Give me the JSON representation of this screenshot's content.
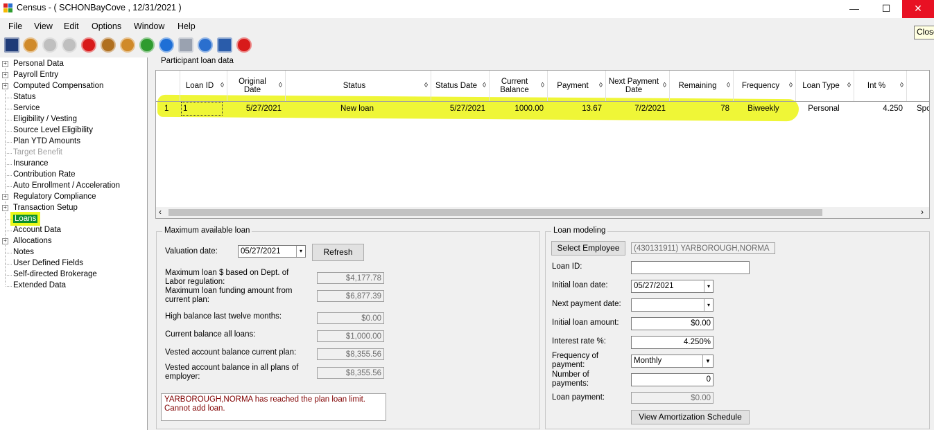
{
  "window": {
    "title": "Census -  ( SCHONBayCove , 12/31/2021 )",
    "minimize": "—",
    "maximize": "☐",
    "close": "✕",
    "tooltip": "Close"
  },
  "menu": [
    "File",
    "View",
    "Edit",
    "Options",
    "Window",
    "Help"
  ],
  "toolbar": [
    {
      "icon": "save-icon",
      "color": "#1f3b78"
    },
    {
      "icon": "person-search-icon",
      "color": "#d08a2a"
    },
    {
      "icon": "add-icon",
      "color": "#bfbfbf"
    },
    {
      "icon": "up-icon",
      "color": "#bfbfbf"
    },
    {
      "icon": "remove-icon",
      "color": "#d81a1a"
    },
    {
      "icon": "group-icon",
      "color": "#b07020"
    },
    {
      "icon": "person-icon",
      "color": "#d08a2a"
    },
    {
      "icon": "person-green-icon",
      "color": "#2f9b2f"
    },
    {
      "icon": "at-icon",
      "color": "#1e6fd6"
    },
    {
      "icon": "print-icon",
      "color": "#9aa2b0"
    },
    {
      "icon": "info-icon",
      "color": "#2a6fce"
    },
    {
      "icon": "edit-icon",
      "color": "#2a5caa"
    },
    {
      "icon": "exit-icon",
      "color": "#d81a1a"
    }
  ],
  "tree": [
    {
      "label": "Personal Data",
      "expandable": true
    },
    {
      "label": "Payroll Entry",
      "expandable": true
    },
    {
      "label": "Computed Compensation",
      "expandable": true
    },
    {
      "label": "Status",
      "expandable": false
    },
    {
      "label": "Service",
      "expandable": false
    },
    {
      "label": "Eligibility / Vesting",
      "expandable": false
    },
    {
      "label": "Source Level Eligibility",
      "expandable": false
    },
    {
      "label": "Plan YTD Amounts",
      "expandable": false
    },
    {
      "label": "Target Benefit",
      "expandable": false,
      "disabled": true
    },
    {
      "label": "Insurance",
      "expandable": false
    },
    {
      "label": "Contribution Rate",
      "expandable": false
    },
    {
      "label": "Auto Enrollment / Acceleration",
      "expandable": false
    },
    {
      "label": "Regulatory Compliance",
      "expandable": true
    },
    {
      "label": "Transaction Setup",
      "expandable": true
    },
    {
      "label": "Loans",
      "expandable": false,
      "selected": true
    },
    {
      "label": "Account Data",
      "expandable": false
    },
    {
      "label": "Allocations",
      "expandable": true
    },
    {
      "label": "Notes",
      "expandable": false
    },
    {
      "label": "User Defined Fields",
      "expandable": false
    },
    {
      "label": "Self-directed Brokerage",
      "expandable": false
    },
    {
      "label": "Extended Data",
      "expandable": false
    }
  ],
  "loan_grid": {
    "title": "Participant loan data",
    "columns": [
      "Loan ID",
      "Original Date",
      "Status",
      "Status Date",
      "Current Balance",
      "Payment",
      "Next Payment Date",
      "Remaining",
      "Frequency",
      "Loan Type",
      "Int %"
    ],
    "sort_glyph": "◊",
    "rows": [
      {
        "num": "1",
        "loan_id": "1",
        "original_date": "5/27/2021",
        "status": "New loan",
        "status_date": "5/27/2021",
        "current_balance": "1000.00",
        "payment": "13.67",
        "next_payment_date": "7/2/2021",
        "remaining": "78",
        "frequency": "Biweekly",
        "loan_type": "Personal",
        "int": "4.250",
        "extra": "Spo"
      }
    ],
    "scroll_left": "‹",
    "scroll_right": "›"
  },
  "max_loan": {
    "title": "Maximum available loan",
    "valuation_label": "Valuation date:",
    "valuation_date": "05/27/2021",
    "refresh": "Refresh",
    "fields": [
      {
        "label": "Maximum loan $ based on Dept. of Labor regulation:",
        "value": "$4,177.78"
      },
      {
        "label": "Maximum loan funding amount from current plan:",
        "value": "$6,877.39"
      },
      {
        "label": "High balance last twelve months:",
        "value": "$0.00"
      },
      {
        "label": "Current balance all loans:",
        "value": "$1,000.00"
      },
      {
        "label": "Vested account balance current plan:",
        "value": "$8,355.56"
      },
      {
        "label": "Vested account balance in all plans of employer:",
        "value": "$8,355.56"
      }
    ],
    "message": "YARBOROUGH,NORMA has reached the plan loan limit. Cannot add loan."
  },
  "modeling": {
    "title": "Loan modeling",
    "select_employee": "Select Employee",
    "employee": "(430131911) YARBOROUGH,NORMA",
    "loan_id_label": "Loan ID:",
    "loan_id": "",
    "initial_date_label": "Initial loan date:",
    "initial_date": "05/27/2021",
    "next_payment_label": "Next payment date:",
    "next_payment": "",
    "initial_amount_label": "Initial loan amount:",
    "initial_amount": "$0.00",
    "interest_label": "Interest rate %:",
    "interest": "4.250%",
    "frequency_label": "Frequency of payment:",
    "frequency": "Monthly",
    "num_payments_label": "Number of payments:",
    "num_payments": "0",
    "loan_payment_label": "Loan payment:",
    "loan_payment": "$0.00",
    "amortization": "View Amortization Schedule"
  }
}
